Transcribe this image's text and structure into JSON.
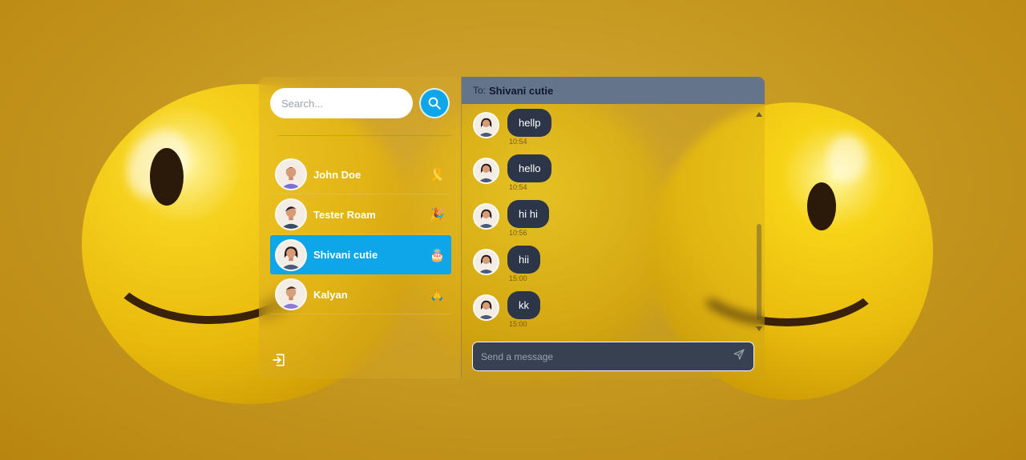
{
  "search": {
    "placeholder": "Search..."
  },
  "contacts": [
    {
      "name": "John Doe",
      "emoji": "🎗️",
      "active": false,
      "avatar": "man-avatar-icon"
    },
    {
      "name": "Tester Roam",
      "emoji": "🎉",
      "active": false,
      "avatar": "man-avatar-icon"
    },
    {
      "name": "Shivani cutie",
      "emoji": "🎂",
      "active": true,
      "avatar": "woman-avatar-icon"
    },
    {
      "name": "Kalyan",
      "emoji": "🙏",
      "active": false,
      "avatar": "man-avatar-icon"
    }
  ],
  "chat": {
    "to_label": "To:",
    "recipient": "Shivani cutie",
    "messages": [
      {
        "text": "hellp",
        "time": "10:54"
      },
      {
        "text": "hello",
        "time": "10:54"
      },
      {
        "text": "hi hi",
        "time": "10:56"
      },
      {
        "text": "hii",
        "time": "15:00"
      },
      {
        "text": "kk",
        "time": "15:00"
      }
    ],
    "composer_placeholder": "Send a message"
  },
  "icons": {
    "search": "search-icon",
    "logout": "logout-icon",
    "send": "send-icon"
  },
  "colors": {
    "accent": "#0ea5e9",
    "header": "#64748b",
    "bubble": "#2d3648",
    "composer": "#374151"
  }
}
